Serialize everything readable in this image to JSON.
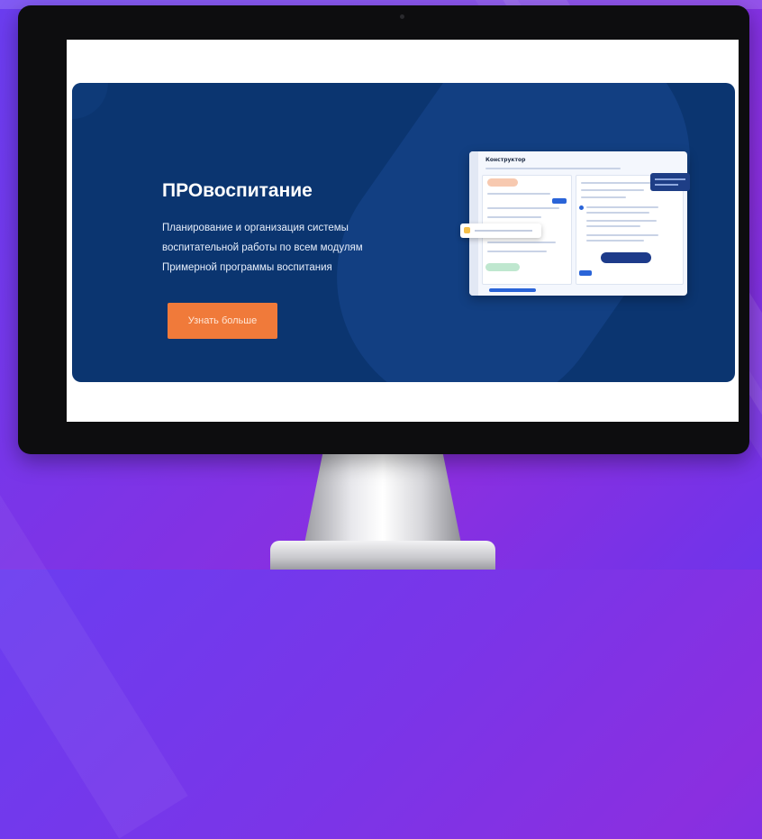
{
  "banner": {
    "title": "ПРОвоспитание",
    "description_lines": [
      "Планирование и организация системы",
      "воспитательной работы по всем модулям",
      "Примерной программы воспитания"
    ],
    "cta_label": "Узнать больше"
  },
  "mockup": {
    "title": "Конструктор"
  },
  "colors": {
    "background": "#7a35e8",
    "banner": "#0b3570",
    "cta": "#f07a3a",
    "accent_blue": "#2a64d8"
  }
}
